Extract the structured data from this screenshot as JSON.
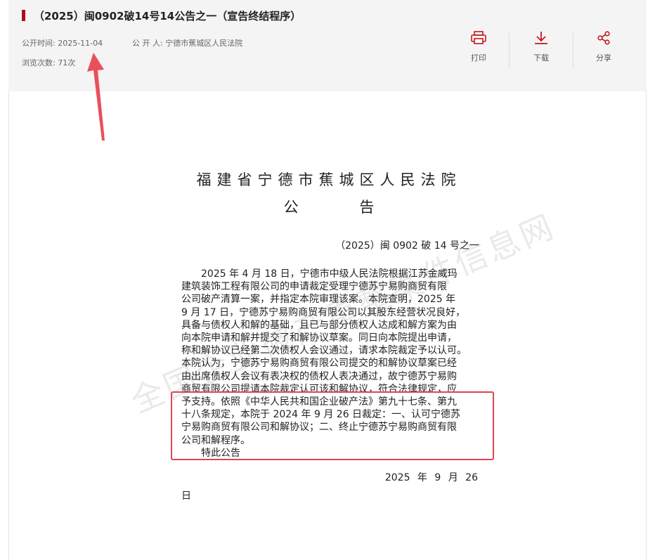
{
  "header": {
    "title": "（2025）闽0902破14号14公告之一（宣告终结程序）",
    "publish_time_label": "公开时间:",
    "publish_time": "2025-11-04",
    "publisher_label": "公 开 人:",
    "publisher": "宁德市蕉城区人民法院",
    "views_label": "浏览次数:",
    "views": "71次"
  },
  "actions": {
    "print": "打印",
    "download": "下载",
    "share": "分享"
  },
  "document": {
    "court_name": "福建省宁德市蕉城区人民法院",
    "heading": "公 告",
    "case_number": "（2025）闽 0902 破 14 号之一",
    "lines": [
      "　　2025 年 4 月 18 日，宁德市中级人民法院根据江苏金威玛",
      "建筑装饰工程有限公司的申请裁定受理宁德苏宁易购商贸有限",
      "公司破产清算一案，并指定本院审理该案。本院查明，2025 年",
      "9 月 17 日，宁德苏宁易购商贸有限公司以其股东经营状况良好，",
      "具备与债权人和解的基础，且已与部分债权人达成和解方案为由",
      "向本院申请和解并提交了和解协议草案。同日向本院提出申请，",
      "称和解协议已经第二次债权人会议通过，请求本院裁定予以认可。",
      "本院认为，宁德苏宁易购商贸有限公司提交的和解协议草案已经",
      "由出席债权人会议有表决权的债权人表决通过，故宁德苏宁易购",
      "商贸有限公司提请本院裁定认可该和解协议，符合法律规定，应",
      "予支持。依照《中华人民共和国企业破产法》第九十七条、第九",
      "十八条规定，本院于 2024 年 9 月 26 日裁定：一、认可宁德苏",
      "宁易购商贸有限公司和解协议；二、终止宁德苏宁易购商贸有限",
      "公司和解程序。",
      "　　特此公告"
    ],
    "date_line": "2025 年 9 月 26",
    "date_tail": "日",
    "watermark": "全国企业破产重整案件信息网"
  },
  "colors": {
    "accent_red": "#b10e17",
    "highlight_red": "#e04555",
    "header_bg": "#f4f4f4"
  }
}
